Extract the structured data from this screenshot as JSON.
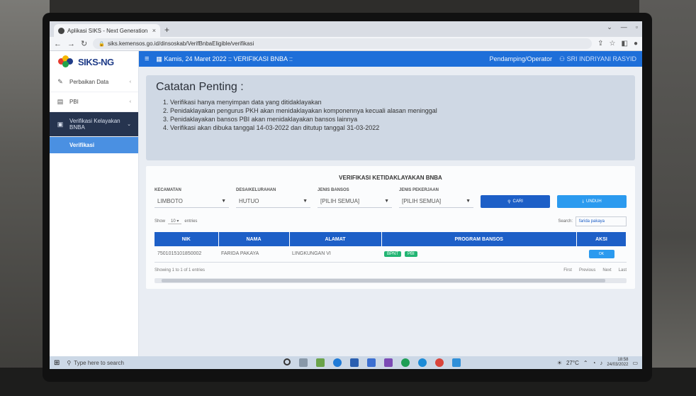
{
  "browser": {
    "tab_title": "Aplikasi SIKS - Next Generation",
    "tab_close": "×",
    "new_tab": "+",
    "url": "siks.kemensos.go.id/dinsoskab/VerifBnbaEligible/verifikasi"
  },
  "app": {
    "logo_text": "SIKS-NG",
    "topbar": {
      "date": "Kamis, 24 Maret 2022 :: VERIFIKASI BNBA ::",
      "role": "Pendamping/Operator",
      "user": "SRI INDRIYANI RASYID"
    },
    "sidebar": {
      "items": [
        {
          "label": "Perbaikan Data"
        },
        {
          "label": "PBI"
        },
        {
          "label": "Verifikasi Kelayakan BNBA"
        }
      ],
      "subitem": "Verifikasi"
    }
  },
  "notice": {
    "title": "Catatan Penting :",
    "items": [
      "1. Verifikasi hanya menyimpan data yang ditidaklayakan",
      "2. Penidaklayakan pengurus PKH akan menidaklayakan komponennya kecuali alasan meninggal",
      "3. Penidaklayakan bansos PBI akan menidaklayakan bansos lainnya",
      "4. Verifikasi akan dibuka tanggal 14-03-2022 dan ditutup tanggal 31-03-2022"
    ]
  },
  "panel": {
    "title": "VERIFIKASI KETIDAKLAYAKAN BNBA",
    "filters": {
      "kecamatan": {
        "label": "KECAMATAN",
        "value": "LIMBOTO"
      },
      "desa": {
        "label": "DESA/KELURAHAN",
        "value": "HUTUO"
      },
      "bansos": {
        "label": "JENIS BANSOS",
        "value": "[PILIH SEMUA]"
      },
      "pekerjaan": {
        "label": "JENIS PEKERJAAN",
        "value": "[PILIH SEMUA]"
      }
    },
    "cari_label": "CARI",
    "unduh_label": "UNDUH",
    "show_label": "Show",
    "show_value": "10",
    "entries_label": "entries",
    "search_label": "Search:",
    "search_value": "farida pakaya"
  },
  "table": {
    "headers": [
      "NIK",
      "NAMA",
      "ALAMAT",
      "PROGRAM BANSOS",
      "AKSI"
    ],
    "rows": [
      {
        "nik": "7501015101850002",
        "nama": "FARIDA PAKAYA",
        "alamat": "LINGKUNGAN VI",
        "badges": [
          "BPNT",
          "PBI"
        ],
        "aksi": "OK"
      }
    ],
    "footer": "Showing 1 to 1 of 1 entries",
    "pager": [
      "First",
      "Previous",
      "Next",
      "Last"
    ]
  },
  "taskbar": {
    "search_placeholder": "Type here to search",
    "temperature": "27°C",
    "time": "18:58",
    "date": "24/03/2022"
  }
}
